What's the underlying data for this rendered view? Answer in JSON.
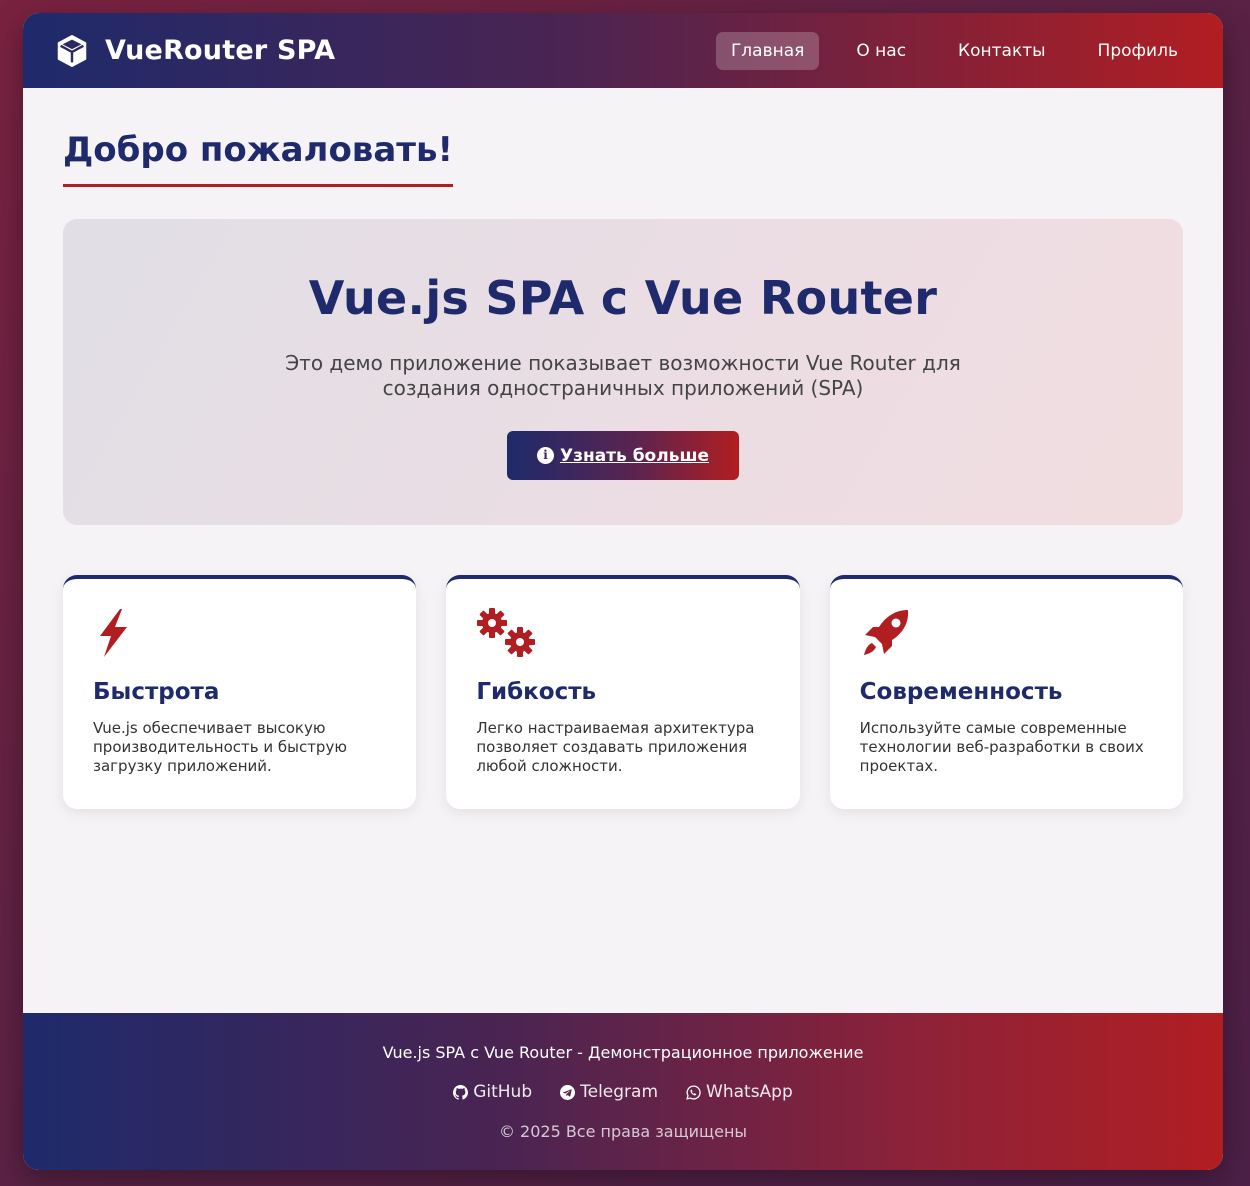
{
  "header": {
    "brand": "VueRouter SPA",
    "brand_icon": "cube-icon",
    "nav": [
      {
        "label": "Главная",
        "active": true
      },
      {
        "label": "О нас",
        "active": false
      },
      {
        "label": "Контакты",
        "active": false
      },
      {
        "label": "Профиль",
        "active": false
      }
    ]
  },
  "main": {
    "title": "Добро пожаловать!",
    "hero": {
      "title": "Vue.js SPA с Vue Router",
      "text": "Это демо приложение показывает возможности Vue Router для создания одностраничных приложений (SPA)",
      "button_label": "Узнать больше",
      "button_icon": "info-icon"
    },
    "cards": [
      {
        "icon": "bolt-icon",
        "title": "Быстрота",
        "text": "Vue.js обеспечивает высокую производительность и быструю загрузку приложений."
      },
      {
        "icon": "gears-icon",
        "title": "Гибкость",
        "text": "Легко настраиваемая архитектура позволяет создавать приложения любой сложности."
      },
      {
        "icon": "rocket-icon",
        "title": "Современность",
        "text": "Используйте самые современные технологии веб-разработки в своих проектах."
      }
    ]
  },
  "footer": {
    "title": "Vue.js SPA с Vue Router - Демонстрационное приложение",
    "links": [
      {
        "label": "GitHub",
        "icon": "github-icon"
      },
      {
        "label": "Telegram",
        "icon": "telegram-icon"
      },
      {
        "label": "WhatsApp",
        "icon": "whatsapp-icon"
      }
    ],
    "copyright": "© 2025 Все права защищены"
  },
  "colors": {
    "primary": "#1e2a6b",
    "accent": "#b11e22",
    "background": "#f6f3f6"
  }
}
